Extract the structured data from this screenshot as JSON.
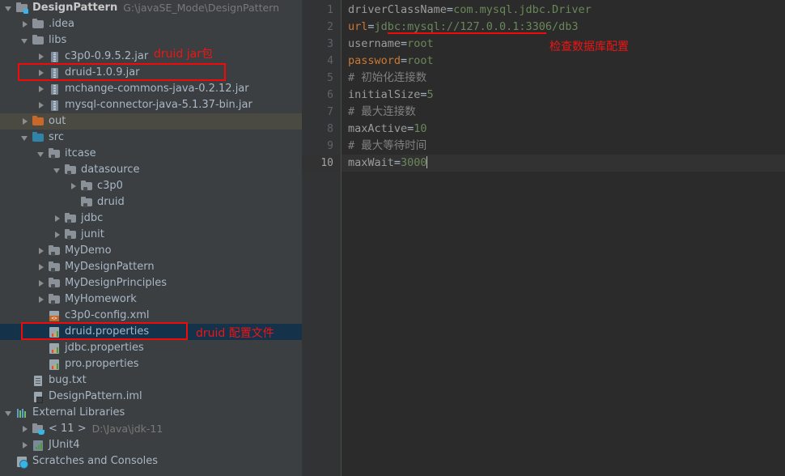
{
  "project_tree": {
    "name": "project-tool-window",
    "rows": [
      {
        "indent": 0,
        "arrow": "open",
        "icon": "project-icon",
        "label": "DesignPattern",
        "bold": true,
        "path": "G:\\javaSE_Mode\\DesignPattern",
        "state": "normal"
      },
      {
        "indent": 1,
        "arrow": "closed",
        "icon": "folder-gray-icon",
        "label": ".idea",
        "state": "normal"
      },
      {
        "indent": 1,
        "arrow": "open",
        "icon": "folder-gray-icon",
        "label": "libs",
        "state": "normal"
      },
      {
        "indent": 2,
        "arrow": "closed",
        "icon": "jar-icon",
        "label": "c3p0-0.9.5.2.jar",
        "state": "normal"
      },
      {
        "indent": 2,
        "arrow": "closed",
        "icon": "jar-icon",
        "label": "druid-1.0.9.jar",
        "state": "normal"
      },
      {
        "indent": 2,
        "arrow": "closed",
        "icon": "jar-icon",
        "label": "mchange-commons-java-0.2.12.jar",
        "state": "normal"
      },
      {
        "indent": 2,
        "arrow": "closed",
        "icon": "jar-icon",
        "label": "mysql-connector-java-5.1.37-bin.jar",
        "state": "normal"
      },
      {
        "indent": 1,
        "arrow": "closed",
        "icon": "folder-orange-icon",
        "label": "out",
        "state": "hover"
      },
      {
        "indent": 1,
        "arrow": "open",
        "icon": "folder-blue-icon",
        "label": "src",
        "state": "normal"
      },
      {
        "indent": 2,
        "arrow": "open",
        "icon": "package-icon",
        "label": "itcase",
        "state": "normal"
      },
      {
        "indent": 3,
        "arrow": "open",
        "icon": "package-icon",
        "label": "datasource",
        "state": "normal"
      },
      {
        "indent": 4,
        "arrow": "closed",
        "icon": "package-icon",
        "label": "c3p0",
        "state": "normal"
      },
      {
        "indent": 4,
        "arrow": "none",
        "icon": "package-icon",
        "label": "druid",
        "state": "normal"
      },
      {
        "indent": 3,
        "arrow": "closed",
        "icon": "package-icon",
        "label": "jdbc",
        "state": "normal"
      },
      {
        "indent": 3,
        "arrow": "closed",
        "icon": "package-icon",
        "label": "junit",
        "state": "normal"
      },
      {
        "indent": 2,
        "arrow": "closed",
        "icon": "package-icon",
        "label": "MyDemo",
        "state": "normal"
      },
      {
        "indent": 2,
        "arrow": "closed",
        "icon": "package-icon",
        "label": "MyDesignPattern",
        "state": "normal"
      },
      {
        "indent": 2,
        "arrow": "closed",
        "icon": "package-icon",
        "label": "MyDesignPrinciples",
        "state": "normal"
      },
      {
        "indent": 2,
        "arrow": "closed",
        "icon": "package-icon",
        "label": "MyHomework",
        "state": "normal"
      },
      {
        "indent": 2,
        "arrow": "none",
        "icon": "xml-file-icon",
        "label": "c3p0-config.xml",
        "state": "normal"
      },
      {
        "indent": 2,
        "arrow": "none",
        "icon": "properties-file-icon",
        "label": "druid.properties",
        "state": "selected"
      },
      {
        "indent": 2,
        "arrow": "none",
        "icon": "properties-file-icon",
        "label": "jdbc.properties",
        "state": "normal"
      },
      {
        "indent": 2,
        "arrow": "none",
        "icon": "properties-file-icon",
        "label": "pro.properties",
        "state": "normal"
      },
      {
        "indent": 1,
        "arrow": "none",
        "icon": "text-file-icon",
        "label": "bug.txt",
        "state": "normal"
      },
      {
        "indent": 1,
        "arrow": "none",
        "icon": "iml-file-icon",
        "label": "DesignPattern.iml",
        "state": "normal"
      },
      {
        "indent": 0,
        "arrow": "open",
        "icon": "external-libraries-icon",
        "label": "External Libraries",
        "state": "normal"
      },
      {
        "indent": 1,
        "arrow": "closed",
        "icon": "jdk-icon",
        "label": "< 11 >",
        "path": "D:\\Java\\jdk-11",
        "state": "normal"
      },
      {
        "indent": 1,
        "arrow": "closed",
        "icon": "junit-icon",
        "label": "JUnit4",
        "state": "normal"
      },
      {
        "indent": 0,
        "arrow": "none",
        "icon": "scratches-icon",
        "label": "Scratches and Consoles",
        "state": "normal"
      }
    ]
  },
  "editor": {
    "name": "druid.properties",
    "line_numbers": [
      "1",
      "2",
      "3",
      "4",
      "5",
      "6",
      "7",
      "8",
      "9",
      "10"
    ],
    "current_line": 10,
    "lines": [
      {
        "n": 1,
        "tokens": [
          {
            "t": "driverClassName",
            "c": "k"
          },
          {
            "t": "=",
            "c": "eq"
          },
          {
            "t": "com.mysql.jdbc.Driver",
            "c": "v"
          }
        ]
      },
      {
        "n": 2,
        "tokens": [
          {
            "t": "url",
            "c": "ku"
          },
          {
            "t": "=",
            "c": "eq"
          },
          {
            "t": "jdbc:mysql://127.0.0.1:3306/db3",
            "c": "v"
          }
        ]
      },
      {
        "n": 3,
        "tokens": [
          {
            "t": "username",
            "c": "k"
          },
          {
            "t": "=",
            "c": "eq"
          },
          {
            "t": "root",
            "c": "v"
          }
        ]
      },
      {
        "n": 4,
        "tokens": [
          {
            "t": "password",
            "c": "ku"
          },
          {
            "t": "=",
            "c": "eq"
          },
          {
            "t": "root",
            "c": "v"
          }
        ]
      },
      {
        "n": 5,
        "tokens": [
          {
            "t": "# 初始化连接数",
            "c": "cm"
          }
        ]
      },
      {
        "n": 6,
        "tokens": [
          {
            "t": "initialSize",
            "c": "k"
          },
          {
            "t": "=",
            "c": "eq"
          },
          {
            "t": "5",
            "c": "v"
          }
        ]
      },
      {
        "n": 7,
        "tokens": [
          {
            "t": "# 最大连接数",
            "c": "cm"
          }
        ]
      },
      {
        "n": 8,
        "tokens": [
          {
            "t": "maxActive",
            "c": "k"
          },
          {
            "t": "=",
            "c": "eq"
          },
          {
            "t": "10",
            "c": "v"
          }
        ]
      },
      {
        "n": 9,
        "tokens": [
          {
            "t": "# 最大等待时间",
            "c": "cm"
          }
        ]
      },
      {
        "n": 10,
        "tokens": [
          {
            "t": "maxWait",
            "c": "k"
          },
          {
            "t": "=",
            "c": "eq"
          },
          {
            "t": "3000",
            "c": "v"
          }
        ]
      }
    ]
  },
  "annotations": {
    "jar_note": "druid jar包",
    "config_note": "druid 配置文件",
    "db_note": "检查数据库配置",
    "color": "#f20a0a"
  }
}
